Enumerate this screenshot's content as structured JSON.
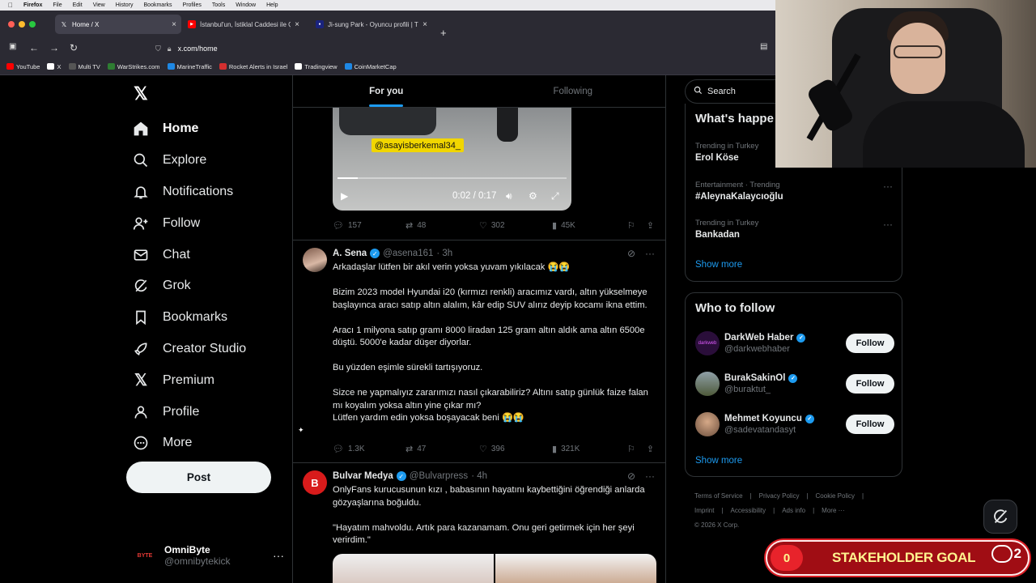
{
  "menubar": {
    "app": "Firefox",
    "items": [
      "File",
      "Edit",
      "View",
      "History",
      "Bookmarks",
      "Profiles",
      "Tools",
      "Window",
      "Help"
    ]
  },
  "tabs": [
    {
      "title": "Home / X",
      "icon": "x-icon",
      "active": true
    },
    {
      "title": "İstanbul'un, İstiklal Caddesi ile Ç",
      "icon": "youtube-icon",
      "active": false
    },
    {
      "title": "Ji-sung Park - Oyuncu profili | Tr",
      "icon": "site-icon",
      "active": false
    }
  ],
  "url": "x.com/home",
  "bookmarks": [
    {
      "label": "YouTube",
      "color": "#ff0000"
    },
    {
      "label": "X",
      "color": "#ffffff"
    },
    {
      "label": "Multi TV",
      "color": "#555555"
    },
    {
      "label": "WarStrikes.com",
      "color": "#2e7d32"
    },
    {
      "label": "MarineTraffic",
      "color": "#1e88e5"
    },
    {
      "label": "Rocket Alerts in Israel",
      "color": "#d32f2f"
    },
    {
      "label": "Tradingview",
      "color": "#ffffff"
    },
    {
      "label": "CoinMarketCap",
      "color": "#1e88e5"
    }
  ],
  "nav": [
    {
      "label": "Home",
      "icon": "home-icon"
    },
    {
      "label": "Explore",
      "icon": "search-icon"
    },
    {
      "label": "Notifications",
      "icon": "bell-icon"
    },
    {
      "label": "Follow",
      "icon": "person-plus-icon"
    },
    {
      "label": "Chat",
      "icon": "mail-icon"
    },
    {
      "label": "Grok",
      "icon": "grok-icon"
    },
    {
      "label": "Bookmarks",
      "icon": "bookmark-icon"
    },
    {
      "label": "Creator Studio",
      "icon": "rocket-icon"
    },
    {
      "label": "Premium",
      "icon": "x-icon"
    },
    {
      "label": "Profile",
      "icon": "person-icon"
    },
    {
      "label": "More",
      "icon": "more-circle-icon"
    }
  ],
  "post_button": "Post",
  "account": {
    "name": "OmniByte",
    "handle": "@omnibytekick",
    "avatar_text": "BYTE"
  },
  "timeline_tabs": [
    "For you",
    "Following"
  ],
  "video": {
    "watermark": "@asayisberkemal34_",
    "time": "0:02 / 0:17",
    "progress": 0.09
  },
  "video_actions": {
    "replies": "157",
    "reposts": "48",
    "likes": "302",
    "views": "45K"
  },
  "tweet1": {
    "author": "A. Sena",
    "handle": "@asena161",
    "time": "· 3h",
    "text": "Arkadaşlar lütfen bir akıl verin yoksa yuvam yıkılacak 😭😭\n\nBizim 2023 model Hyundai i20 (kırmızı renkli) aracımız vardı, altın yükselmeye başlayınca aracı satıp altın alalım, kâr edip SUV alırız deyip kocamı ikna ettim.\n\nAracı 1 milyona satıp gramı 8000 liradan 125 gram altın aldık ama altın 6500e düştü. 5000'e kadar düşer diyorlar.\n\nBu yüzden eşimle sürekli tartışıyoruz.\n\nSizce ne yapmalıyız zararımızı nasıl çıkarabiliriz? Altını satıp günlük faize falan mı koyalım yoksa altın yine çıkar mı?\nLütfen yardım edin yoksa boşayacak beni 😭😭",
    "replies": "1.3K",
    "reposts": "47",
    "likes": "396",
    "views": "321K"
  },
  "tweet2": {
    "author": "Bulvar Medya",
    "handle": "@Bulvarpress",
    "time": "· 4h",
    "text": "OnlyFans kurucusunun kızı , babasının hayatını kaybettiğini öğrendiği anlarda gözyaşlarına boğuldu.\n\n\"Hayatım mahvoldu. Artık para kazanamam. Onu geri getirmek için her şeyi verirdim.\""
  },
  "search": {
    "placeholder": "Search"
  },
  "trends": {
    "title": "What's happe",
    "items": [
      {
        "meta": "Trending in Turkey",
        "name": "Erol Köse"
      },
      {
        "meta": "Entertainment · Trending",
        "name": "#AleynaKalaycıoğlu"
      },
      {
        "meta": "Trending in Turkey",
        "name": "Bankadan"
      }
    ],
    "show_more": "Show more"
  },
  "who_to_follow": {
    "title": "Who to follow",
    "items": [
      {
        "name": "DarkWeb Haber",
        "handle": "@darkwebhaber",
        "button": "Follow",
        "avatar_color": "#2a0e3a",
        "avatar_text": "darkweb"
      },
      {
        "name": "BurakSakinOl",
        "handle": "@buraktut_",
        "button": "Follow",
        "avatar_color": "#4e5a3a",
        "avatar_text": ""
      },
      {
        "name": "Mehmet Koyuncu",
        "handle": "@sadevatandasyt",
        "button": "Follow",
        "avatar_color": "#b08a6e",
        "avatar_text": ""
      }
    ],
    "show_more": "Show more"
  },
  "footer": {
    "links": [
      "Terms of Service",
      "|",
      "Privacy Policy",
      "|",
      "Cookie Policy",
      "|",
      "Imprint",
      "|",
      "Accessibility",
      "|",
      "Ads info",
      "|",
      "More ···"
    ],
    "copyright": "© 2026 X Corp."
  },
  "goal": {
    "count": "0",
    "label": "STAKEHOLDER GOAL",
    "chat_count": "2"
  },
  "colors": {
    "accent": "#1d9bf0",
    "background": "#000000",
    "goal_red": "#a00d14"
  }
}
